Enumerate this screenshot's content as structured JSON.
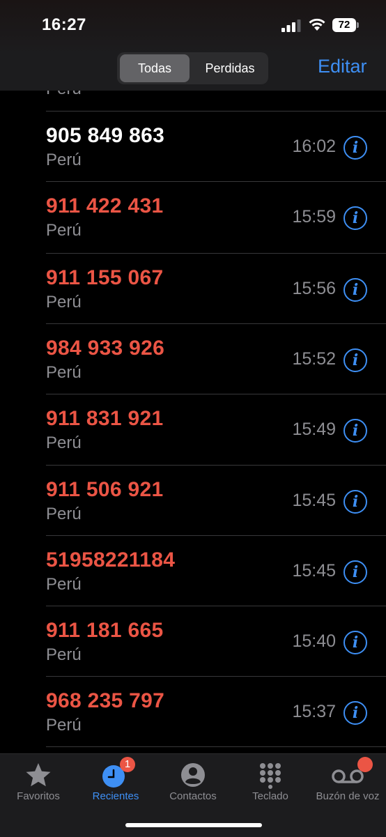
{
  "status_bar": {
    "time": "16:27",
    "battery": "72"
  },
  "header": {
    "segments": [
      "Todas",
      "Perdidas"
    ],
    "selected_segment": "Todas",
    "edit_label": "Editar"
  },
  "partial_row_subtitle": "Perú",
  "calls": [
    {
      "number": "905 849 863",
      "location": "Perú",
      "time": "16:02",
      "missed": false
    },
    {
      "number": "911 422 431",
      "location": "Perú",
      "time": "15:59",
      "missed": true
    },
    {
      "number": "911 155 067",
      "location": "Perú",
      "time": "15:56",
      "missed": true
    },
    {
      "number": "984 933 926",
      "location": "Perú",
      "time": "15:52",
      "missed": true
    },
    {
      "number": "911 831 921",
      "location": "Perú",
      "time": "15:49",
      "missed": true
    },
    {
      "number": "911 506 921",
      "location": "Perú",
      "time": "15:45",
      "missed": true
    },
    {
      "number": "51958221184",
      "location": "Perú",
      "time": "15:45",
      "missed": true
    },
    {
      "number": "911 181 665",
      "location": "Perú",
      "time": "15:40",
      "missed": true
    },
    {
      "number": "968 235 797",
      "location": "Perú",
      "time": "15:37",
      "missed": true
    }
  ],
  "tab_bar": {
    "tabs": [
      {
        "label": "Favoritos",
        "icon": "star-icon"
      },
      {
        "label": "Recientes",
        "icon": "clock-icon",
        "badge": "1",
        "active": true
      },
      {
        "label": "Contactos",
        "icon": "person-circle-icon"
      },
      {
        "label": "Teclado",
        "icon": "keypad-icon"
      },
      {
        "label": "Buzón de voz",
        "icon": "voicemail-icon"
      }
    ]
  },
  "colors": {
    "accent": "#3e8ff4",
    "missed": "#eb5545",
    "secondary_text": "#8e8e93"
  }
}
